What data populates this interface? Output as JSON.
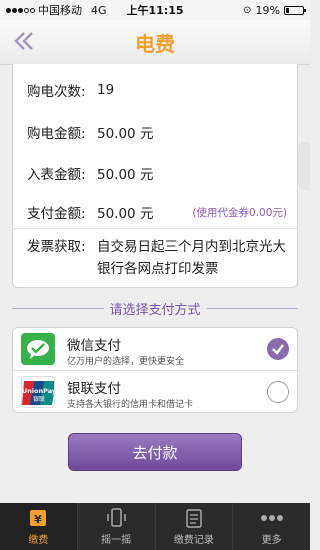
{
  "status_bar": {
    "carrier": "中国移动",
    "network": "4G",
    "time": "上午11:15",
    "battery": "19%",
    "battery_level": 0.19
  },
  "header": {
    "title": "电费",
    "back_icon": "double-chevron-left-icon"
  },
  "details": {
    "count_label": "购电次数:",
    "count_value": "19",
    "amount_label": "购电金额:",
    "amount_value": "50.00 元",
    "meter_label": "入表金额:",
    "meter_value": "50.00 元",
    "paid_label": "支付金额:",
    "paid_value": "50.00 元",
    "coupon_note": "(使用代金券0.00元)",
    "invoice_label": "发票获取:",
    "invoice_value": "自交易日起三个月内到北京光大银行各网点打印发票"
  },
  "payment": {
    "section_title": "请选择支付方式",
    "methods": [
      {
        "name": "微信支付",
        "desc": "亿万用户的选择，更快更安全",
        "icon": "wechat-pay-icon",
        "selected": true
      },
      {
        "name": "银联支付",
        "desc": "支持各大银行的信用卡和借记卡",
        "icon": "unionpay-icon",
        "selected": false
      }
    ],
    "pay_button": "去付款"
  },
  "tabs": [
    {
      "label": "缴费",
      "icon": "payment-icon",
      "active": true
    },
    {
      "label": "摇一摇",
      "icon": "phone-shake-icon",
      "active": false
    },
    {
      "label": "缴费记录",
      "icon": "record-icon",
      "active": false
    },
    {
      "label": "更多",
      "icon": "more-icon",
      "active": false
    }
  ],
  "colors": {
    "accent_purple": "#7b55a8",
    "title_orange": "#f0a030",
    "wechat_green": "#35b24a"
  }
}
